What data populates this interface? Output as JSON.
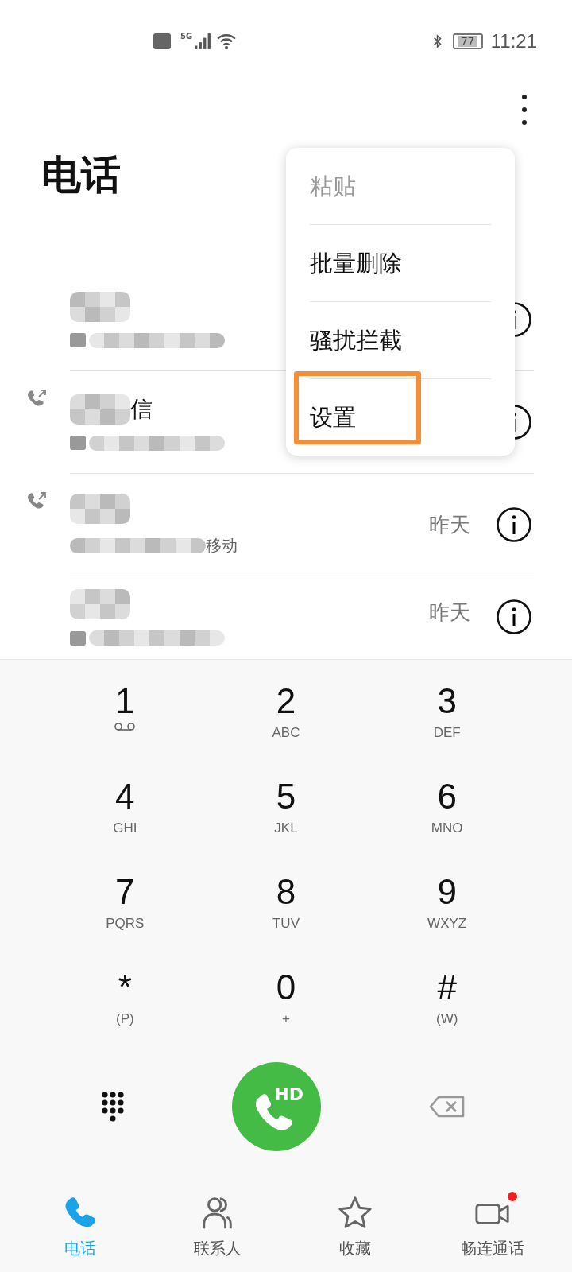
{
  "status_bar": {
    "time": "11:21",
    "battery": "77",
    "network": "5G"
  },
  "title": "电话",
  "menu": {
    "items": [
      {
        "label": "粘贴",
        "disabled": true,
        "highlighted": false
      },
      {
        "label": "批量删除",
        "disabled": false,
        "highlighted": false
      },
      {
        "label": "骚扰拦截",
        "disabled": false,
        "highlighted": false
      },
      {
        "label": "设置",
        "disabled": false,
        "highlighted": true
      }
    ]
  },
  "calls": [
    {
      "outgoing": false,
      "hd": true
    },
    {
      "outgoing": true,
      "hd": true,
      "name_tail": "信"
    },
    {
      "outgoing": true,
      "hd": false,
      "detail_tail": "移动",
      "time": "昨天"
    },
    {
      "outgoing": false,
      "hd": true,
      "time": "昨天"
    }
  ],
  "keypad": [
    {
      "digit": "1",
      "kind": "voicemail"
    },
    {
      "digit": "2",
      "letters": "ABC",
      "kind": "letters"
    },
    {
      "digit": "3",
      "letters": "DEF",
      "kind": "letters"
    },
    {
      "digit": "4",
      "letters": "GHI",
      "kind": "letters"
    },
    {
      "digit": "5",
      "letters": "JKL",
      "kind": "letters"
    },
    {
      "digit": "6",
      "letters": "MNO",
      "kind": "letters"
    },
    {
      "digit": "7",
      "letters": "PQRS",
      "kind": "letters"
    },
    {
      "digit": "8",
      "letters": "TUV",
      "kind": "letters"
    },
    {
      "digit": "9",
      "letters": "WXYZ",
      "kind": "letters"
    },
    {
      "digit": "*",
      "letters": "(P)",
      "kind": "letters"
    },
    {
      "digit": "0",
      "letters": "+",
      "kind": "letters"
    },
    {
      "digit": "#",
      "letters": "(W)",
      "kind": "letters"
    }
  ],
  "call_button": {
    "label": "HD"
  },
  "nav": [
    {
      "label": "电话",
      "kind": "phone",
      "selected": true,
      "badge": false
    },
    {
      "label": "联系人",
      "kind": "contacts",
      "selected": false,
      "badge": false
    },
    {
      "label": "收藏",
      "kind": "star",
      "selected": false,
      "badge": false
    },
    {
      "label": "畅连通话",
      "kind": "video",
      "selected": false,
      "badge": true
    }
  ]
}
